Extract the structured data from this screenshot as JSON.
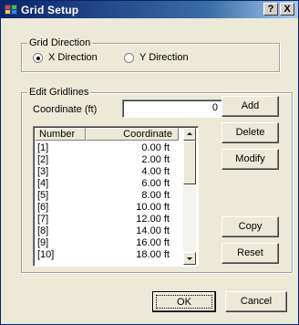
{
  "window": {
    "title": "Grid Setup",
    "help_label": "?",
    "close_label": "X"
  },
  "grid_direction": {
    "legend": "Grid Direction",
    "options": [
      {
        "label": "X Direction",
        "selected": true
      },
      {
        "label": "Y Direction",
        "selected": false
      }
    ]
  },
  "edit_gridlines": {
    "legend": "Edit Gridlines",
    "coordinate_label": "Coordinate (ft)",
    "coordinate_value": "0",
    "columns": [
      "Number",
      "Coordinate"
    ],
    "rows": [
      {
        "number": "[1]",
        "coordinate": "0.00 ft"
      },
      {
        "number": "[2]",
        "coordinate": "2.00 ft"
      },
      {
        "number": "[3]",
        "coordinate": "4.00 ft"
      },
      {
        "number": "[4]",
        "coordinate": "6.00 ft"
      },
      {
        "number": "[5]",
        "coordinate": "8.00 ft"
      },
      {
        "number": "[6]",
        "coordinate": "10.00 ft"
      },
      {
        "number": "[7]",
        "coordinate": "12.00 ft"
      },
      {
        "number": "[8]",
        "coordinate": "14.00 ft"
      },
      {
        "number": "[9]",
        "coordinate": "16.00 ft"
      },
      {
        "number": "[10]",
        "coordinate": "18.00 ft"
      }
    ],
    "buttons": {
      "add": "Add",
      "delete": "Delete",
      "modify": "Modify",
      "copy": "Copy",
      "reset": "Reset"
    }
  },
  "footer": {
    "ok": "OK",
    "cancel": "Cancel"
  }
}
